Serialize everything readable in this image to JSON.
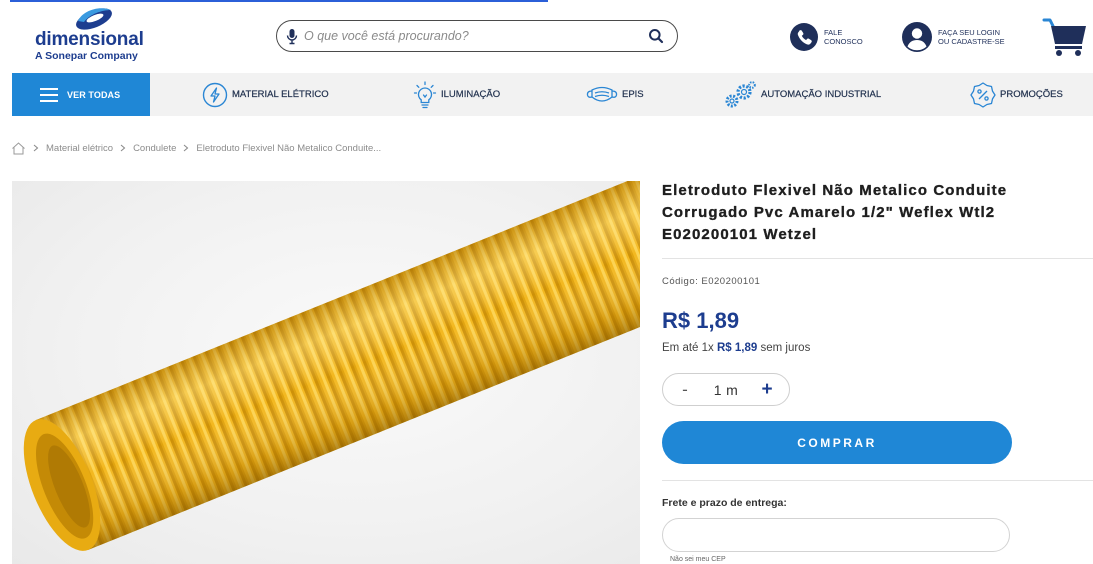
{
  "colors": {
    "primary": "#1f87d6",
    "navy": "#1f2f5a",
    "price": "#1d3d8f",
    "icon_blue": "#2a86d4",
    "nav_bg": "#f2f2f2",
    "tube_yellow": "#f3b81f",
    "link_blue": "#2b5fd8"
  },
  "header": {
    "logo": {
      "name": "dimensional",
      "tagline": "A Sonepar Company"
    },
    "search": {
      "placeholder": "O que você está procurando?",
      "mic_icon": "microphone-icon",
      "search_icon": "search-icon"
    },
    "contact": {
      "icon": "phone-icon",
      "line1": "FALE",
      "line2": "CONOSCO"
    },
    "account": {
      "icon": "user-icon",
      "line1": "FAÇA SEU LOGIN",
      "line2": "OU CADASTRE-SE"
    },
    "cart": {
      "icon": "cart-icon"
    }
  },
  "nav": {
    "all_categories": {
      "icon": "menu-icon",
      "label": "VER TODAS"
    },
    "items": [
      {
        "label": "MATERIAL ELÉTRICO",
        "icon": "lightning-icon"
      },
      {
        "label": "ILUMINAÇÃO",
        "icon": "lightbulb-icon"
      },
      {
        "label": "EPIS",
        "icon": "face-mask-icon"
      },
      {
        "label": "AUTOMAÇÃO INDUSTRIAL",
        "icon": "gears-icon"
      },
      {
        "label": "PROMOÇÕES",
        "icon": "percent-badge-icon"
      }
    ]
  },
  "breadcrumb": {
    "home_icon": "home-icon",
    "separator_icon": "chevron-right-icon",
    "items": [
      {
        "label": "Material elétrico"
      },
      {
        "label": "Condulete"
      },
      {
        "label": "Eletroduto Flexivel Não Metalico Conduite..."
      }
    ]
  },
  "product": {
    "title": "Eletroduto Flexivel Não Metalico Conduite Corrugado Pvc Amarelo 1/2\" Weflex Wtl2 E020200101 Wetzel",
    "code_label": "Código:",
    "code": "E020200101",
    "price": "R$ 1,89",
    "installments": {
      "prefix": "Em até 1x",
      "amount": "R$ 1,89",
      "suffix": "sem juros"
    },
    "quantity": {
      "decrement_label": "-",
      "value": "1",
      "unit": "m",
      "increment_label": "+"
    },
    "buy_label": "COMPRAR",
    "shipping": {
      "label": "Frete e prazo de entrega:",
      "unknown_cep_link": "Não sei meu CEP"
    }
  }
}
